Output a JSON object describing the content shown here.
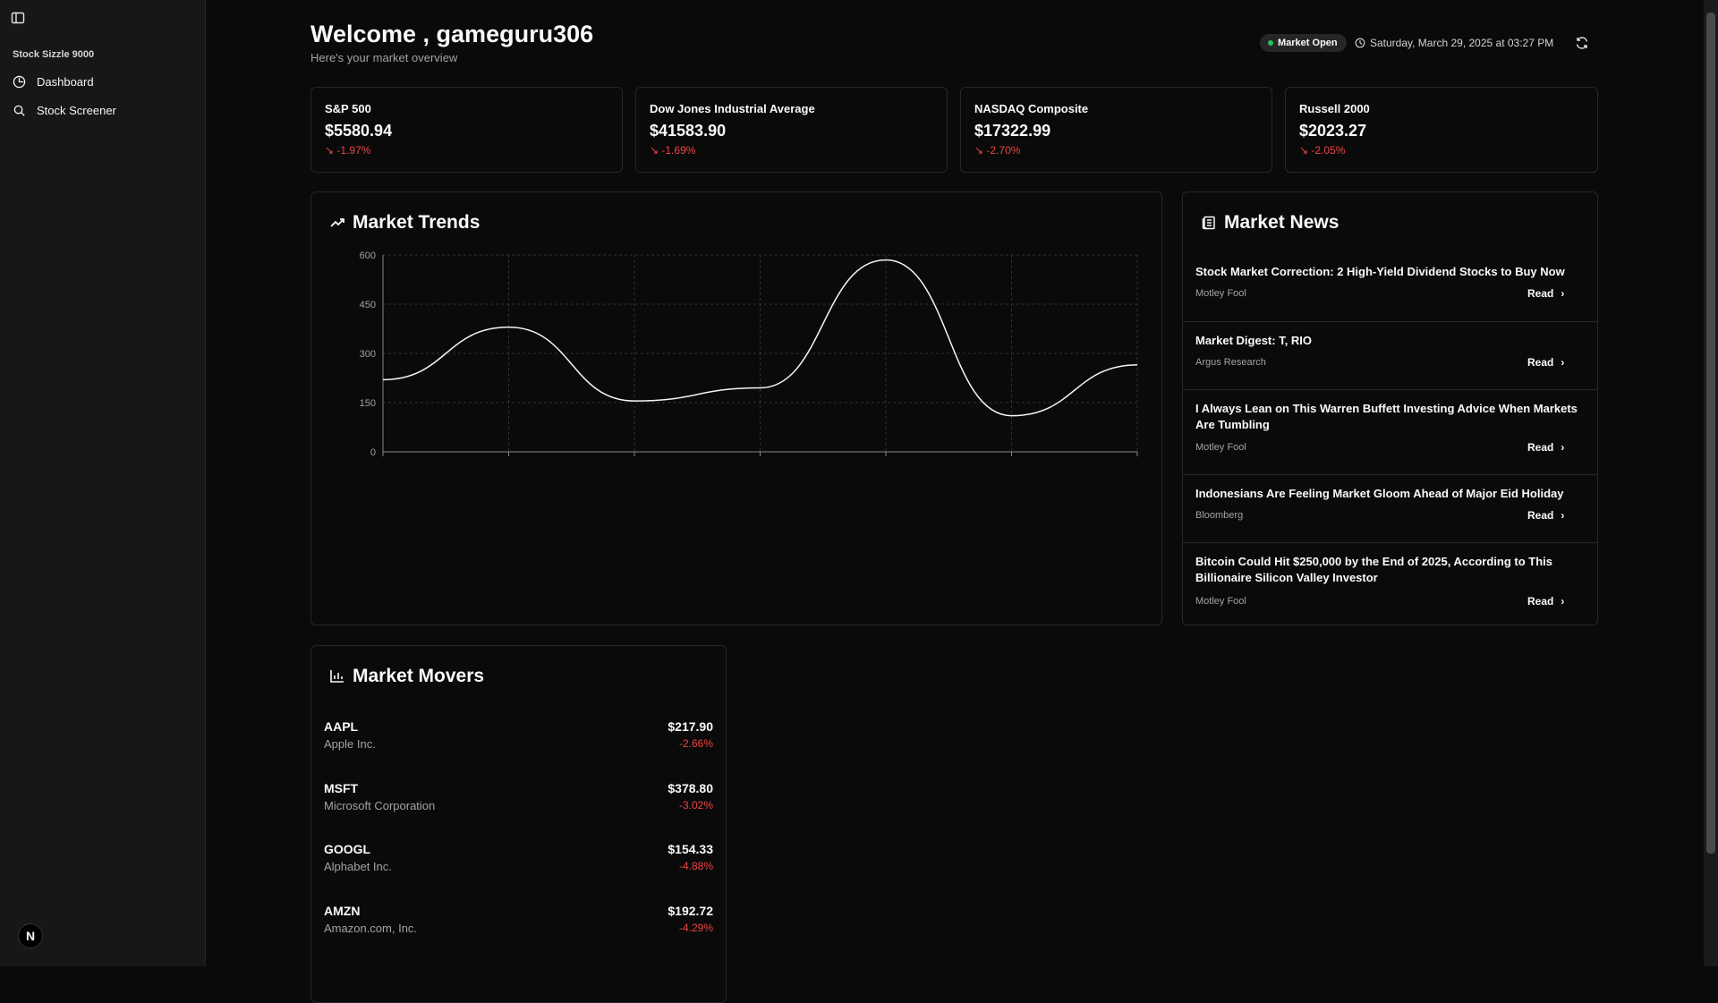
{
  "app_name": "Stock Sizzle 9000",
  "sidebar": {
    "items": [
      {
        "label": "Dashboard",
        "icon": "clock-pie-icon"
      },
      {
        "label": "Stock Screener",
        "icon": "search-icon"
      }
    ],
    "avatar_letter": "N"
  },
  "header": {
    "welcome": "Welcome , gameguru306",
    "subtitle": "Here's your market overview",
    "market_status": "Market Open",
    "datetime": "Saturday, March 29, 2025 at 03:27 PM"
  },
  "indices": [
    {
      "name": "S&P 500",
      "value": "$5580.94",
      "change": "-1.97%"
    },
    {
      "name": "Dow Jones Industrial Average",
      "value": "$41583.90",
      "change": "-1.69%"
    },
    {
      "name": "NASDAQ Composite",
      "value": "$17322.99",
      "change": "-2.70%"
    },
    {
      "name": "Russell 2000",
      "value": "$2023.27",
      "change": "-2.05%"
    }
  ],
  "trends": {
    "title": "Market Trends",
    "chart_data": {
      "type": "line",
      "x": [
        0,
        1,
        2,
        3,
        4,
        5,
        6
      ],
      "values": [
        220,
        380,
        155,
        195,
        585,
        110,
        265
      ],
      "ylim": [
        0,
        600
      ],
      "yticks": [
        "600",
        "450",
        "300",
        "150",
        "0"
      ],
      "grid": true
    }
  },
  "news": {
    "title": "Market News",
    "read_label": "Read",
    "items": [
      {
        "title": "Stock Market Correction: 2 High-Yield Dividend Stocks to Buy Now",
        "source": "Motley Fool"
      },
      {
        "title": "Market Digest: T, RIO",
        "source": "Argus Research"
      },
      {
        "title": "I Always Lean on This Warren Buffett Investing Advice When Markets Are Tumbling",
        "source": "Motley Fool"
      },
      {
        "title": "Indonesians Are Feeling Market Gloom Ahead of Major Eid Holiday",
        "source": "Bloomberg"
      },
      {
        "title": "Bitcoin Could Hit $250,000 by the End of 2025, According to This Billionaire Silicon Valley Investor",
        "source": "Motley Fool"
      }
    ]
  },
  "movers": {
    "title": "Market Movers",
    "items": [
      {
        "symbol": "AAPL",
        "name": "Apple Inc.",
        "price": "$217.90",
        "change": "-2.66%"
      },
      {
        "symbol": "MSFT",
        "name": "Microsoft Corporation",
        "price": "$378.80",
        "change": "-3.02%"
      },
      {
        "symbol": "GOOGL",
        "name": "Alphabet Inc.",
        "price": "$154.33",
        "change": "-4.88%"
      },
      {
        "symbol": "AMZN",
        "name": "Amazon.com, Inc.",
        "price": "$192.72",
        "change": "-4.29%"
      }
    ]
  }
}
